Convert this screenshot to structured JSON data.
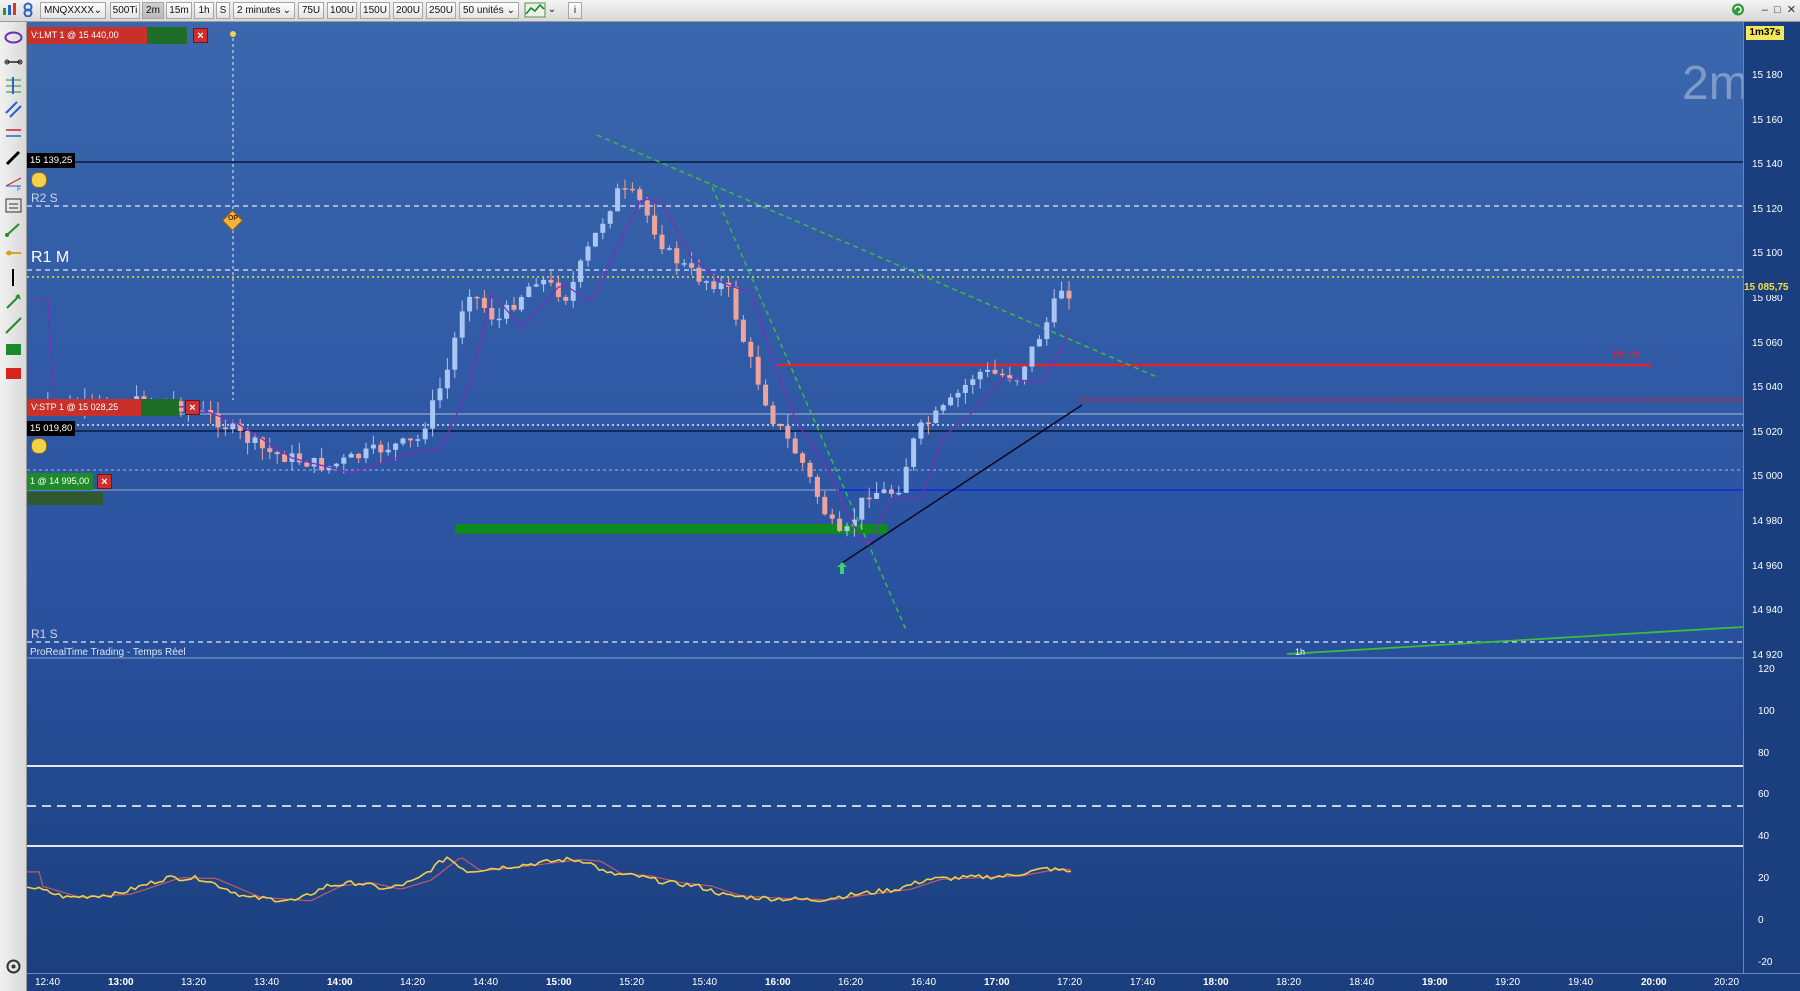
{
  "toolbar": {
    "instrument": "MNQXXXX",
    "buttons": [
      "500Ti",
      "2m",
      "15m",
      "1h",
      "S"
    ],
    "selected": "2m",
    "timeframe_select": "2 minutes",
    "unit_buttons": [
      "75U",
      "100U",
      "150U",
      "200U",
      "250U"
    ],
    "quantity_select": "50 unités"
  },
  "chart": {
    "timeframe_watermark": "2m",
    "countdown": "1m37s",
    "source_label": "ProRealTime Trading - Temps Réel",
    "current_price": "15 085,75",
    "price_ticks": [
      "15 180",
      "15 160",
      "15 140",
      "15 120",
      "15 100",
      "15 080",
      "15 060",
      "15 040",
      "15 020",
      "15 000",
      "14 980",
      "14 960",
      "14 940",
      "14 920"
    ],
    "osc_ticks": [
      "120",
      "100",
      "80",
      "60",
      "40",
      "20",
      "0",
      "-20"
    ],
    "time_ticks": [
      "12:40",
      "13:00",
      "13:20",
      "13:40",
      "14:00",
      "14:20",
      "14:40",
      "15:00",
      "15:20",
      "15:40",
      "16:00",
      "16:20",
      "16:40",
      "17:00",
      "17:20",
      "17:40",
      "18:00",
      "18:20",
      "18:40",
      "19:00",
      "19:20",
      "19:40",
      "20:00",
      "20:20"
    ],
    "bold_time_ticks": [
      "13:00",
      "14:00",
      "15:00",
      "16:00",
      "17:00",
      "18:00",
      "19:00",
      "20:00"
    ],
    "pivots": {
      "r2s": "R2 S",
      "r1m": "R1 M",
      "r1s": "R1 S",
      "piv4h": "Piv 4h",
      "tf1h": "1h"
    },
    "orders": {
      "limit_sell": "V:LMT  1 @ 15 440,00",
      "stop_sell": "V:STP  1 @ 15 028,25",
      "position": "1 @ 14 995,00"
    },
    "price_tags": {
      "high_tag": "15 139,25",
      "low_tag": "15 019,80"
    },
    "op_marker": "OP"
  },
  "colors": {
    "background": "#1b3f7e",
    "bull": "#a9c6f4",
    "bear": "#f0a39a",
    "resistance": "#e02231",
    "support": "#1030d0",
    "oscillator": "#f1cf4a"
  }
}
